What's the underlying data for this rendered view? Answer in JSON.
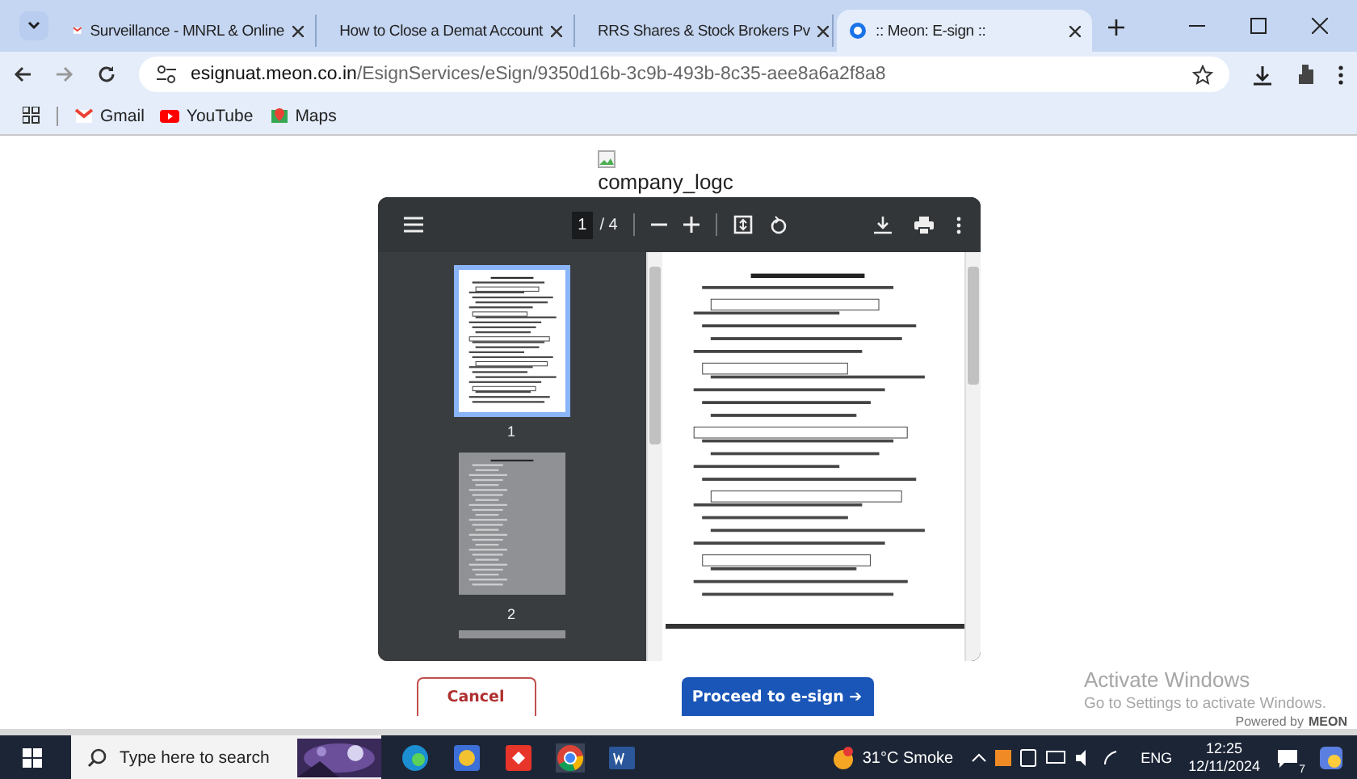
{
  "browser": {
    "tabs": [
      {
        "title": "Surveillance - MNRL & Online",
        "selected": false
      },
      {
        "title": "How to Close a Demat Account",
        "selected": false
      },
      {
        "title": "RRS Shares & Stock Brokers Pv",
        "selected": false
      },
      {
        "title": ":: Meon: E-sign ::",
        "selected": true
      }
    ],
    "url_host": "esignuat.meon.co.in",
    "url_path": "/EsignServices/eSign/9350d16b-3c9b-493b-8c35-aee8a6a2f8a8",
    "bookmarks": [
      {
        "label": "Gmail"
      },
      {
        "label": "YouTube"
      },
      {
        "label": "Maps"
      }
    ]
  },
  "logo_alt": "company_logc",
  "pdf_viewer": {
    "page": "1",
    "total": "/ 4",
    "thumbnails": [
      {
        "label": "1",
        "selected": true
      },
      {
        "label": "2",
        "selected": false
      }
    ]
  },
  "buttons": [
    {
      "label": "Cancel",
      "kind": "secondary"
    },
    {
      "label": "Proceed to e-sign ➔",
      "kind": "primary"
    }
  ],
  "activation": {
    "title": "Activate Windows",
    "text": "Go to Settings to activate Windows."
  },
  "powered_by": {
    "label": "Powered by",
    "brand": "MEON"
  },
  "taskbar": {
    "search_placeholder": "Type here to search",
    "weather": "31°C  Smoke",
    "language": "ENG",
    "time": "12:25",
    "date": "12/11/2024",
    "notifications": "7"
  }
}
